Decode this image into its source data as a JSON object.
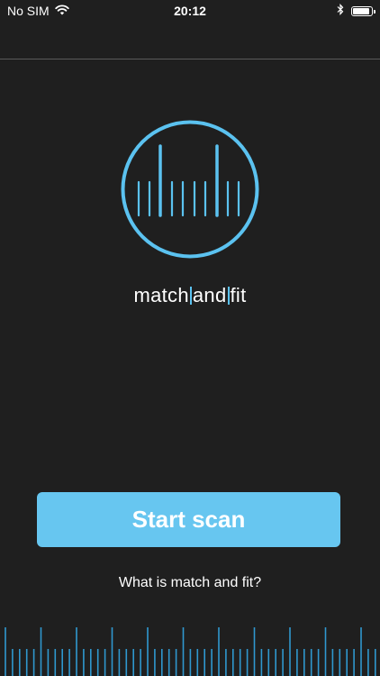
{
  "status_bar": {
    "carrier": "No SIM",
    "time": "20:12",
    "battery_level": 0.9
  },
  "brand": {
    "part1": "match",
    "part2": "and",
    "part3": "fit"
  },
  "actions": {
    "start_label": "Start scan",
    "info_label": "What is match and fit?"
  },
  "colors": {
    "accent": "#67c6f0",
    "logo_accent": "#5bc2f0",
    "background": "#1f1f1f",
    "ruler": "#2f98cf"
  },
  "icons": [
    "wifi-icon",
    "bluetooth-icon",
    "battery-icon",
    "logo-icon"
  ]
}
